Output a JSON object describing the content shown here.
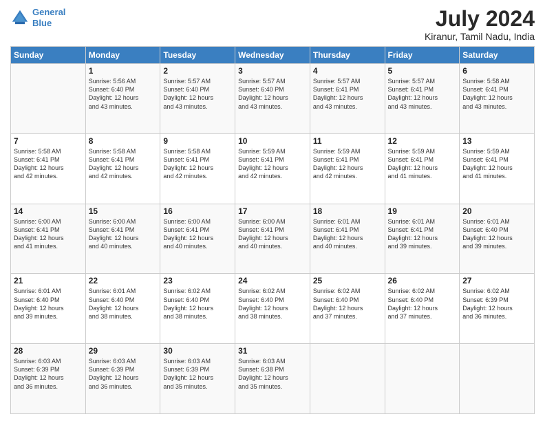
{
  "logo": {
    "line1": "General",
    "line2": "Blue"
  },
  "title": "July 2024",
  "subtitle": "Kiranur, Tamil Nadu, India",
  "weekdays": [
    "Sunday",
    "Monday",
    "Tuesday",
    "Wednesday",
    "Thursday",
    "Friday",
    "Saturday"
  ],
  "weeks": [
    [
      {
        "day": "",
        "text": ""
      },
      {
        "day": "1",
        "text": "Sunrise: 5:56 AM\nSunset: 6:40 PM\nDaylight: 12 hours\nand 43 minutes."
      },
      {
        "day": "2",
        "text": "Sunrise: 5:57 AM\nSunset: 6:40 PM\nDaylight: 12 hours\nand 43 minutes."
      },
      {
        "day": "3",
        "text": "Sunrise: 5:57 AM\nSunset: 6:40 PM\nDaylight: 12 hours\nand 43 minutes."
      },
      {
        "day": "4",
        "text": "Sunrise: 5:57 AM\nSunset: 6:41 PM\nDaylight: 12 hours\nand 43 minutes."
      },
      {
        "day": "5",
        "text": "Sunrise: 5:57 AM\nSunset: 6:41 PM\nDaylight: 12 hours\nand 43 minutes."
      },
      {
        "day": "6",
        "text": "Sunrise: 5:58 AM\nSunset: 6:41 PM\nDaylight: 12 hours\nand 43 minutes."
      }
    ],
    [
      {
        "day": "7",
        "text": "Sunrise: 5:58 AM\nSunset: 6:41 PM\nDaylight: 12 hours\nand 42 minutes."
      },
      {
        "day": "8",
        "text": "Sunrise: 5:58 AM\nSunset: 6:41 PM\nDaylight: 12 hours\nand 42 minutes."
      },
      {
        "day": "9",
        "text": "Sunrise: 5:58 AM\nSunset: 6:41 PM\nDaylight: 12 hours\nand 42 minutes."
      },
      {
        "day": "10",
        "text": "Sunrise: 5:59 AM\nSunset: 6:41 PM\nDaylight: 12 hours\nand 42 minutes."
      },
      {
        "day": "11",
        "text": "Sunrise: 5:59 AM\nSunset: 6:41 PM\nDaylight: 12 hours\nand 42 minutes."
      },
      {
        "day": "12",
        "text": "Sunrise: 5:59 AM\nSunset: 6:41 PM\nDaylight: 12 hours\nand 41 minutes."
      },
      {
        "day": "13",
        "text": "Sunrise: 5:59 AM\nSunset: 6:41 PM\nDaylight: 12 hours\nand 41 minutes."
      }
    ],
    [
      {
        "day": "14",
        "text": "Sunrise: 6:00 AM\nSunset: 6:41 PM\nDaylight: 12 hours\nand 41 minutes."
      },
      {
        "day": "15",
        "text": "Sunrise: 6:00 AM\nSunset: 6:41 PM\nDaylight: 12 hours\nand 40 minutes."
      },
      {
        "day": "16",
        "text": "Sunrise: 6:00 AM\nSunset: 6:41 PM\nDaylight: 12 hours\nand 40 minutes."
      },
      {
        "day": "17",
        "text": "Sunrise: 6:00 AM\nSunset: 6:41 PM\nDaylight: 12 hours\nand 40 minutes."
      },
      {
        "day": "18",
        "text": "Sunrise: 6:01 AM\nSunset: 6:41 PM\nDaylight: 12 hours\nand 40 minutes."
      },
      {
        "day": "19",
        "text": "Sunrise: 6:01 AM\nSunset: 6:41 PM\nDaylight: 12 hours\nand 39 minutes."
      },
      {
        "day": "20",
        "text": "Sunrise: 6:01 AM\nSunset: 6:40 PM\nDaylight: 12 hours\nand 39 minutes."
      }
    ],
    [
      {
        "day": "21",
        "text": "Sunrise: 6:01 AM\nSunset: 6:40 PM\nDaylight: 12 hours\nand 39 minutes."
      },
      {
        "day": "22",
        "text": "Sunrise: 6:01 AM\nSunset: 6:40 PM\nDaylight: 12 hours\nand 38 minutes."
      },
      {
        "day": "23",
        "text": "Sunrise: 6:02 AM\nSunset: 6:40 PM\nDaylight: 12 hours\nand 38 minutes."
      },
      {
        "day": "24",
        "text": "Sunrise: 6:02 AM\nSunset: 6:40 PM\nDaylight: 12 hours\nand 38 minutes."
      },
      {
        "day": "25",
        "text": "Sunrise: 6:02 AM\nSunset: 6:40 PM\nDaylight: 12 hours\nand 37 minutes."
      },
      {
        "day": "26",
        "text": "Sunrise: 6:02 AM\nSunset: 6:40 PM\nDaylight: 12 hours\nand 37 minutes."
      },
      {
        "day": "27",
        "text": "Sunrise: 6:02 AM\nSunset: 6:39 PM\nDaylight: 12 hours\nand 36 minutes."
      }
    ],
    [
      {
        "day": "28",
        "text": "Sunrise: 6:03 AM\nSunset: 6:39 PM\nDaylight: 12 hours\nand 36 minutes."
      },
      {
        "day": "29",
        "text": "Sunrise: 6:03 AM\nSunset: 6:39 PM\nDaylight: 12 hours\nand 36 minutes."
      },
      {
        "day": "30",
        "text": "Sunrise: 6:03 AM\nSunset: 6:39 PM\nDaylight: 12 hours\nand 35 minutes."
      },
      {
        "day": "31",
        "text": "Sunrise: 6:03 AM\nSunset: 6:38 PM\nDaylight: 12 hours\nand 35 minutes."
      },
      {
        "day": "",
        "text": ""
      },
      {
        "day": "",
        "text": ""
      },
      {
        "day": "",
        "text": ""
      }
    ]
  ]
}
